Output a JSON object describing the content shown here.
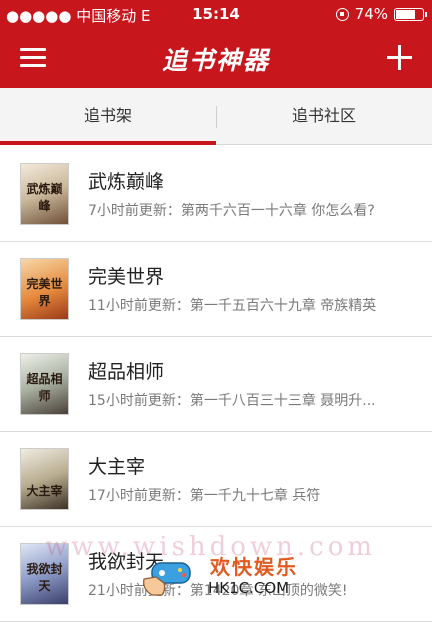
{
  "status_bar": {
    "carrier": "●●●●● 中国移动  E",
    "time": "15:14",
    "battery": "74%",
    "battery_level": 0.74
  },
  "header": {
    "title": "追书神器",
    "menu_icon": "menu-icon",
    "add_icon": "plus-icon"
  },
  "tabs": [
    {
      "label": "追书架",
      "active": true
    },
    {
      "label": "追书社区",
      "active": false
    }
  ],
  "accent_color": "#c8161d",
  "books": [
    {
      "title": "武炼巅峰",
      "update": "7小时前更新：第两千六百一十六章 你怎么看?",
      "cover_text": "武炼巅峰"
    },
    {
      "title": "完美世界",
      "update": "11小时前更新：第一千五百六十九章 帝族精英",
      "cover_text": "完美世界"
    },
    {
      "title": "超品相师",
      "update": "15小时前更新：第一千八百三十三章 聂明升...",
      "cover_text": "超品相师"
    },
    {
      "title": "大主宰",
      "update": "17小时前更新：第一千九十七章 兵符",
      "cover_text": "大主宰"
    },
    {
      "title": "我欲封天",
      "update": "21小时前更新：第1420章 东山顶的微笑!",
      "cover_text": "我欲封天"
    }
  ],
  "watermark": "www.wishdown.com",
  "logo": {
    "cn": "欢快娱乐",
    "en": "HK1C.COM"
  }
}
